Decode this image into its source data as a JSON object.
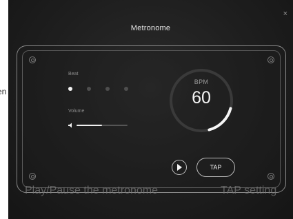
{
  "side_text": "en",
  "dialog": {
    "title": "Metronome",
    "close_glyph": "×"
  },
  "beat": {
    "label": "Beat",
    "count": 4,
    "active_index": 0
  },
  "volume": {
    "label": "Volume",
    "level": 0.5
  },
  "bpm": {
    "label": "BPM",
    "value": "60"
  },
  "controls": {
    "tap_label": "TAP"
  },
  "captions": {
    "play": "Play/Pause the metronome",
    "tap": "TAP setting"
  },
  "colors": {
    "accent": "#f5f5f5",
    "background": "#1e1e1e",
    "border": "#8a8a8a"
  }
}
